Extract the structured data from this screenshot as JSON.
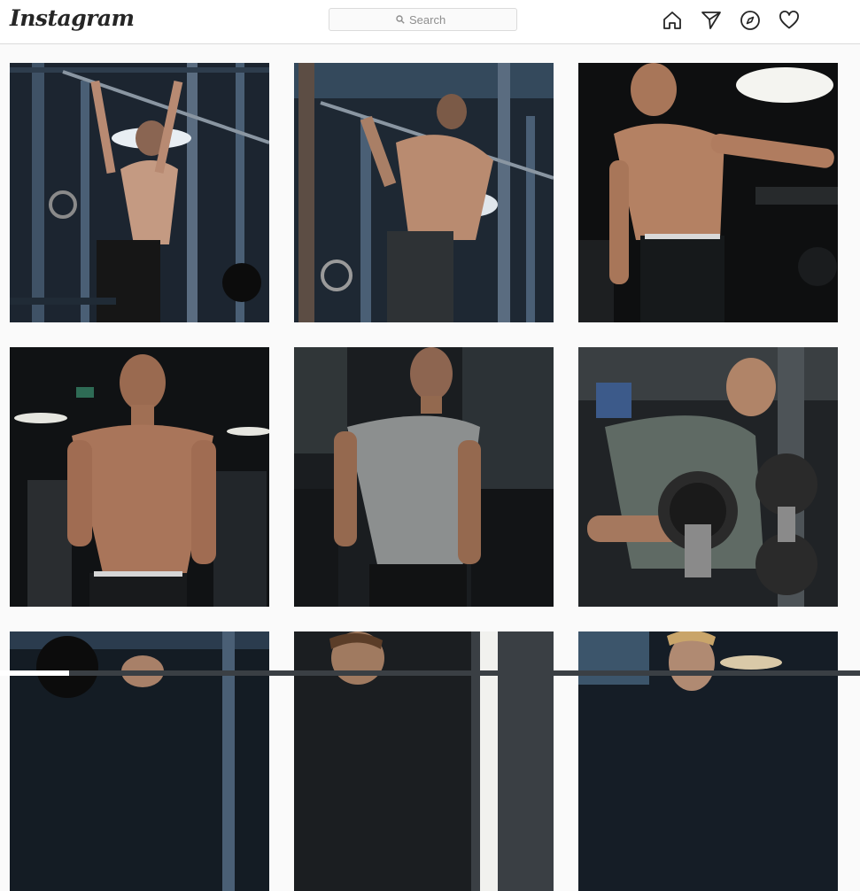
{
  "header": {
    "logo_text": "Instagram",
    "search_placeholder": "Search"
  },
  "nav_icons": [
    "home-icon",
    "direct-message-icon",
    "explore-icon",
    "activity-heart-icon"
  ],
  "posts": [
    {
      "subject": "shirtless man doing pull-up on gym rack",
      "palette": [
        "#1c2530",
        "#2e3d4d",
        "#c49a82"
      ]
    },
    {
      "subject": "man doing pull-up, view from behind",
      "palette": [
        "#1e2833",
        "#34495c",
        "#b98b70"
      ]
    },
    {
      "subject": "shirtless man flexing under gym light",
      "palette": [
        "#0e0f10",
        "#272a2c",
        "#b48163"
      ]
    },
    {
      "subject": "shirtless man posing in dark gym",
      "palette": [
        "#101214",
        "#2a2d30",
        "#a9755a"
      ]
    },
    {
      "subject": "man in grey t-shirt standing in gym",
      "palette": [
        "#1a1d20",
        "#4a5053",
        "#8c8f8f"
      ]
    },
    {
      "subject": "man in grey t-shirt lifting dumbbells",
      "palette": [
        "#202326",
        "#5f6a64",
        "#2a2a2a"
      ]
    },
    {
      "subject": "man at squat rack",
      "palette": [
        "#141c24",
        "#2b3c4e",
        "#a88068"
      ]
    },
    {
      "subject": "man in gym, partial view",
      "palette": [
        "#1b1e21",
        "#3a3f44",
        "#a07a60"
      ]
    },
    {
      "subject": "man near gym window",
      "palette": [
        "#151d26",
        "#3c556b",
        "#b08a72"
      ]
    }
  ]
}
